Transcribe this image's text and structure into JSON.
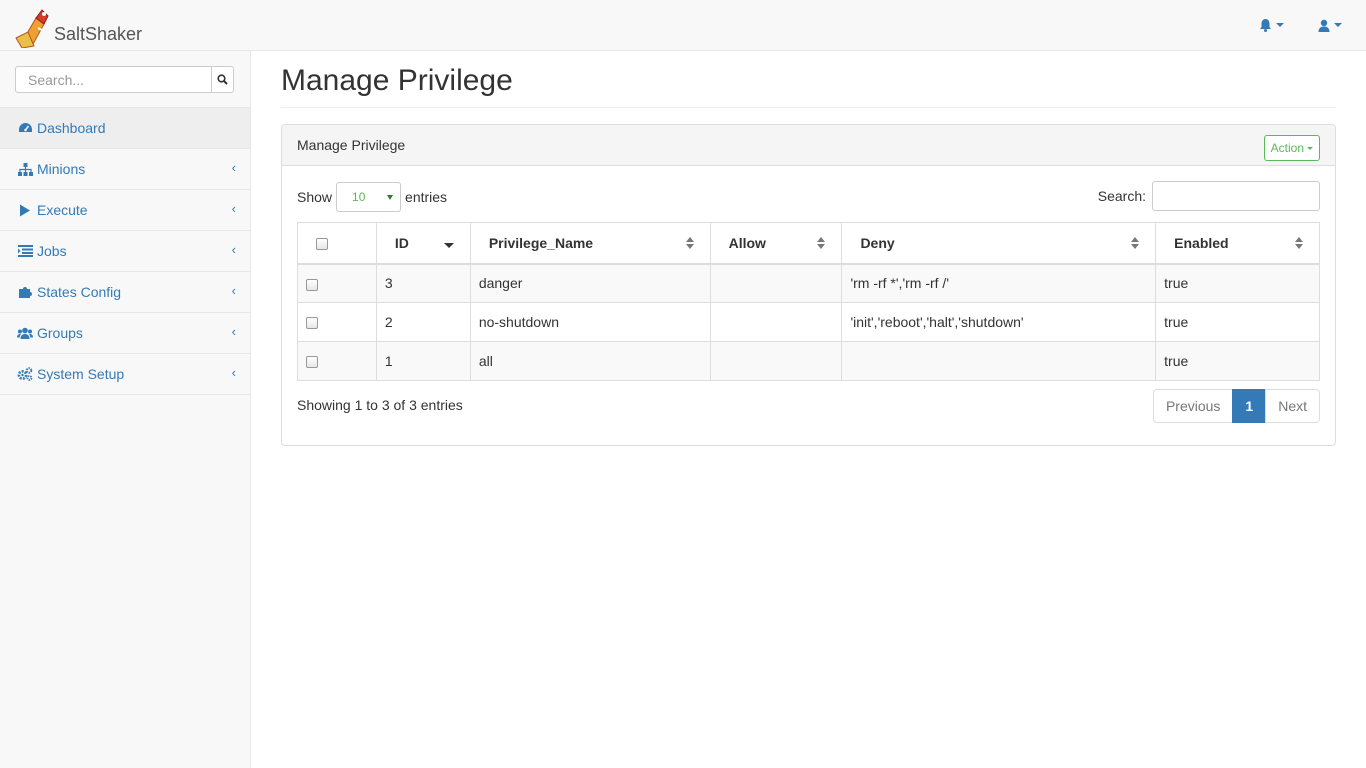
{
  "app": {
    "brand": "SaltShaker",
    "notifications_icon": "bell-icon",
    "user_icon": "user-icon"
  },
  "sidebar": {
    "search_placeholder": "Search...",
    "items": [
      {
        "label": "Dashboard",
        "icon": "dashboard-icon"
      },
      {
        "label": "Minions",
        "icon": "sitemap-icon"
      },
      {
        "label": "Execute",
        "icon": "play-icon"
      },
      {
        "label": "Jobs",
        "icon": "list-icon"
      },
      {
        "label": "States Config",
        "icon": "puzzle-icon"
      },
      {
        "label": "Groups",
        "icon": "users-icon"
      },
      {
        "label": "System Setup",
        "icon": "cogs-icon"
      }
    ]
  },
  "page": {
    "title": "Manage Privilege",
    "panel_title": "Manage Privilege",
    "action_label": "Action"
  },
  "table": {
    "show_label": "Show",
    "page_length": "10",
    "entries_label": "entries",
    "search_label": "Search:",
    "columns": [
      "ID",
      "Privilege_Name",
      "Allow",
      "Deny",
      "Enabled"
    ],
    "rows": [
      {
        "id": "3",
        "name": "danger",
        "allow": "",
        "deny": "'rm -rf *','rm -rf /'",
        "enabled": "true"
      },
      {
        "id": "2",
        "name": "no-shutdown",
        "allow": "",
        "deny": "'init','reboot','halt','shutdown'",
        "enabled": "true"
      },
      {
        "id": "1",
        "name": "all",
        "allow": "",
        "deny": "",
        "enabled": "true"
      }
    ],
    "info": "Showing 1 to 3 of 3 entries",
    "pagination": {
      "previous": "Previous",
      "current": "1",
      "next": "Next"
    }
  },
  "colors": {
    "link": "#337ab7",
    "success": "#5cb85c"
  }
}
